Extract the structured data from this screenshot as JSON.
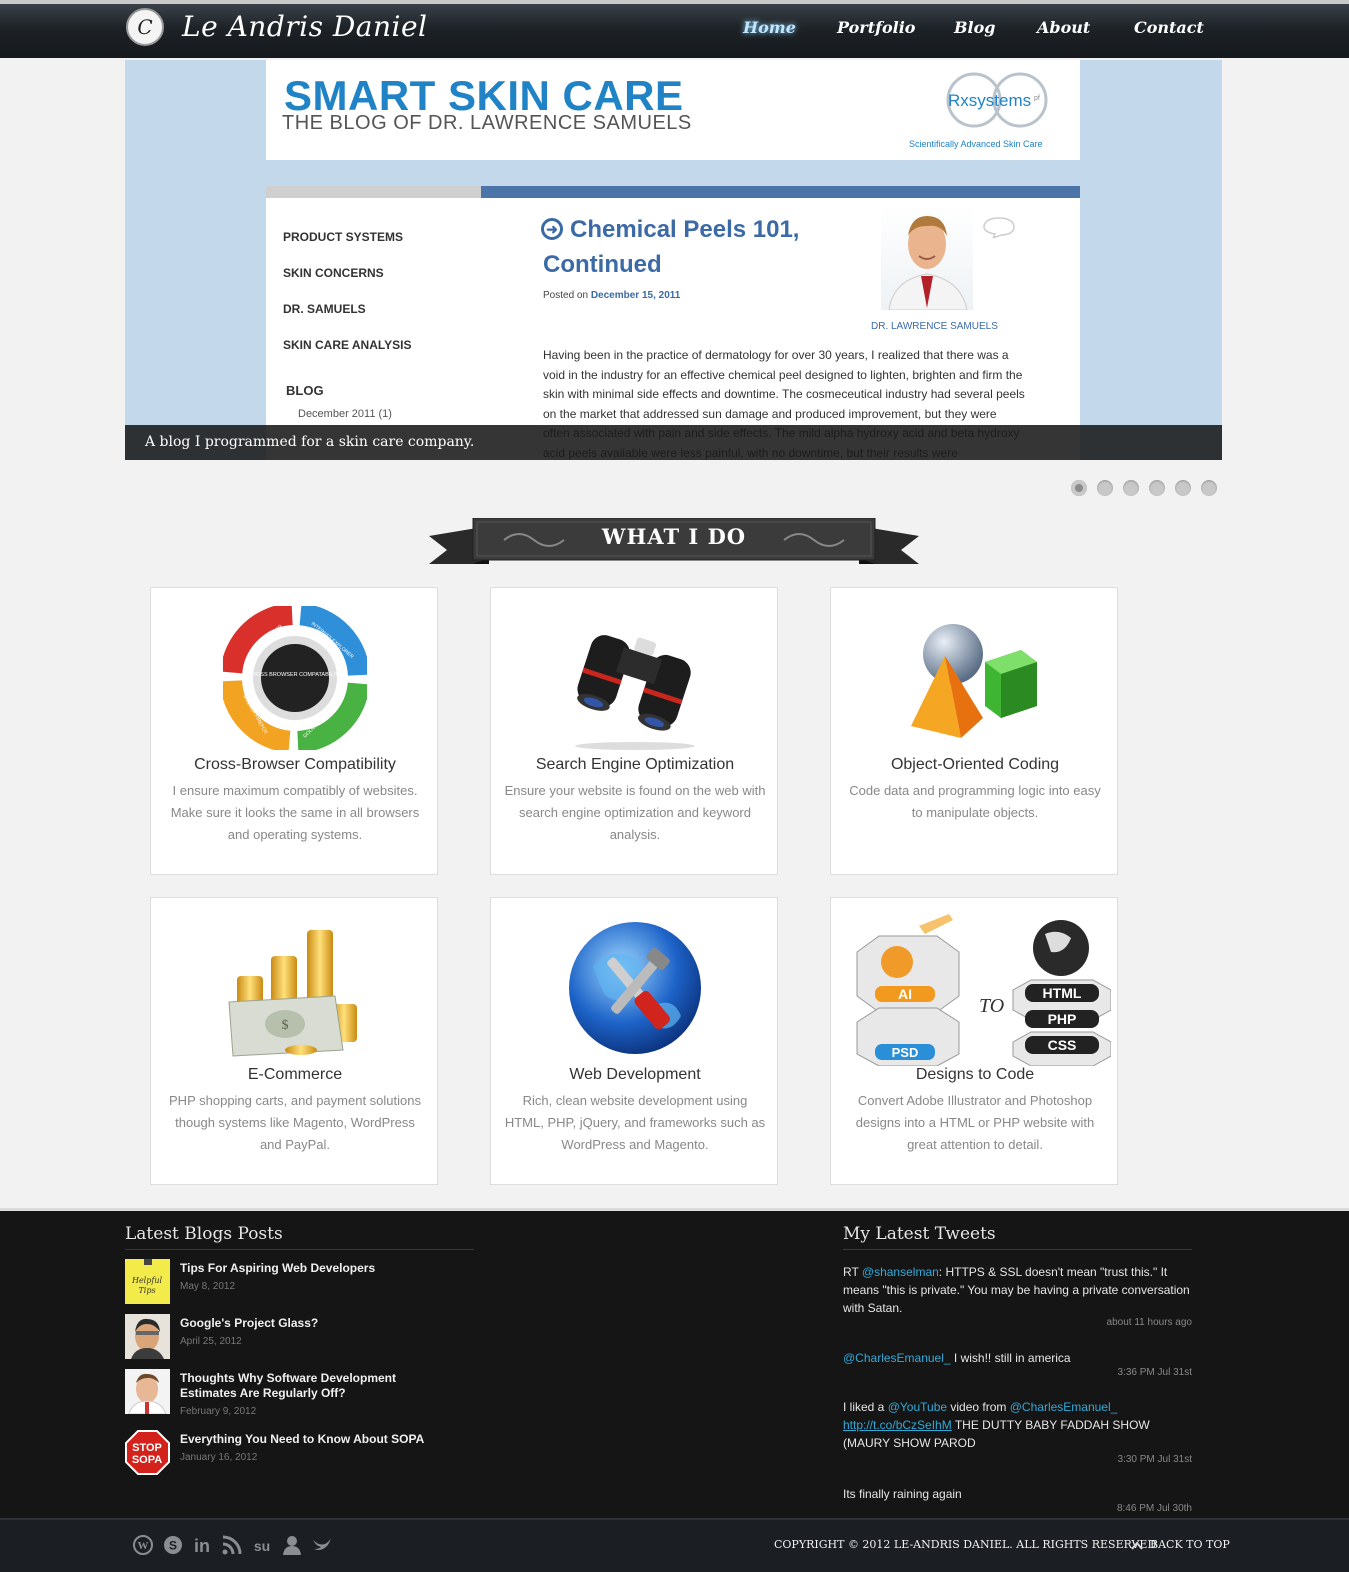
{
  "header": {
    "logo_mark": "C",
    "logo_text": "Le Andris Daniel",
    "nav": [
      "Home",
      "Portfolio",
      "Blog",
      "About",
      "Contact"
    ],
    "active": "Home"
  },
  "slider": {
    "banner_title": "SMART SKIN CARE",
    "banner_subtitle": "THE BLOG OF DR. LAWRENCE SAMUELS",
    "rx_logo": "Rxsystems",
    "rx_logo_suffix": "pf",
    "rx_tagline": "Scientifically Advanced Skin Care",
    "sidebar_items": [
      "PRODUCT SYSTEMS",
      "SKIN CONCERNS",
      "DR. SAMUELS",
      "SKIN CARE ANALYSIS"
    ],
    "sidebar_blog": "BLOG",
    "sidebar_archive": "December 2011 (1)",
    "post_title": "Chemical Peels 101, Continued",
    "posted_label": "Posted on",
    "posted_date": "December 15, 2011",
    "doctor_name": "DR. LAWRENCE SAMUELS",
    "post_body": "Having been in the practice of dermatology for over 30 years, I realized that there was a void in the industry for an effective chemical peel designed to lighten, brighten and firm the skin with minimal side effects and downtime. The cosmeceutical industry had several peels on the market that addressed sun damage and produced improvement, but they were often associated with pain and side effects. The mild alpha hydroxy acid and beta hydroxy acid peels available were less painful, with no downtime, but their results were",
    "caption": "A blog I programmed for a skin care company.",
    "dots": 6,
    "active_dot": 0
  },
  "what_i_do": {
    "title": "WHAT I DO",
    "cards": [
      {
        "icon": "browser-compat-icon",
        "title": "Cross-Browser Compatibility",
        "text": "I ensure maximum compatibly of websites. Make sure it looks the same in all browsers and operating systems.",
        "wheel_center": "CROSS BROWSER COMPATABILITY",
        "wheel_labels": [
          "OPERA BROWSER",
          "INTERNET EXPLORER",
          "GOOGLE CHROME",
          "MOZILLA FIREFOX"
        ]
      },
      {
        "icon": "binoculars-icon",
        "title": "Search Engine Optimization",
        "text": "Ensure your website is found on the web with search engine optimization and keyword analysis."
      },
      {
        "icon": "shapes-icon",
        "title": "Object-Oriented Coding",
        "text": "Code data and programming logic into easy to manipulate objects."
      },
      {
        "icon": "coins-icon",
        "title": "E-Commerce",
        "text": "PHP shopping carts, and payment solutions though systems like Magento, WordPress and PayPal."
      },
      {
        "icon": "globe-tools-icon",
        "title": "Web Development",
        "text": "Rich, clean website development using HTML, PHP, jQuery, and frameworks such as WordPress and Magento."
      },
      {
        "icon": "design-to-code-icon",
        "title": "Designs to Code",
        "text": "Convert Adobe Illustrator and Photoshop designs into a HTML or PHP website with great attention to detail.",
        "badges_left": [
          "AI",
          "PSD"
        ],
        "connector": "TO",
        "badges_right": [
          "HTML",
          "PHP",
          "CSS"
        ]
      }
    ]
  },
  "blog": {
    "heading": "Latest Blogs Posts",
    "posts": [
      {
        "title": "Tips For Aspiring Web Developers",
        "date": "May 8, 2012",
        "thumb": "sticky-note-icon",
        "thumb_text": "Helpful Tips"
      },
      {
        "title": "Google's Project Glass?",
        "date": "April 25, 2012",
        "thumb": "person-photo"
      },
      {
        "title": "Thoughts Why Software Development Estimates Are Regularly Off?",
        "date": "February 9, 2012",
        "thumb": "person-photo"
      },
      {
        "title": "Everything You Need to Know About SOPA",
        "date": "January 16, 2012",
        "thumb": "stop-sopa-icon",
        "thumb_text": "STOP SOPA"
      }
    ]
  },
  "tweets": {
    "heading": "My Latest Tweets",
    "items": [
      {
        "pre": "RT ",
        "mention": "@shanselman",
        "text": ": HTTPS & SSL doesn't mean \"trust this.\" It means \"this is private.\" You may be having a private conversation with Satan.",
        "time": "about 11 hours ago"
      },
      {
        "pre": "",
        "mention": "@CharlesEmanuel_",
        "text": " I wish!! still in america",
        "time": "3:36 PM Jul 31st"
      },
      {
        "pre": "I liked a ",
        "mention": "@YouTube",
        "mid": " video from ",
        "mention2": "@CharlesEmanuel_",
        "link": "http://t.co/bCzSeIhM",
        "text": " THE DUTTY BABY FADDAH SHOW (MAURY SHOW PAROD",
        "time": "3:30 PM Jul 31st"
      },
      {
        "pre": "",
        "mention": "",
        "text": "Its finally raining again",
        "time": "8:46 PM Jul 30th"
      }
    ]
  },
  "bottom": {
    "social": [
      "wordpress-icon",
      "skype-icon",
      "linkedin-icon",
      "rss-icon",
      "stumbleupon-icon",
      "user-icon",
      "twitter-icon"
    ],
    "copyright": "COPYRIGHT © 2012 LE-ANDRIS DANIEL. ALL RIGHTS RESERVED",
    "back_to_top": "BACK TO TOP"
  }
}
